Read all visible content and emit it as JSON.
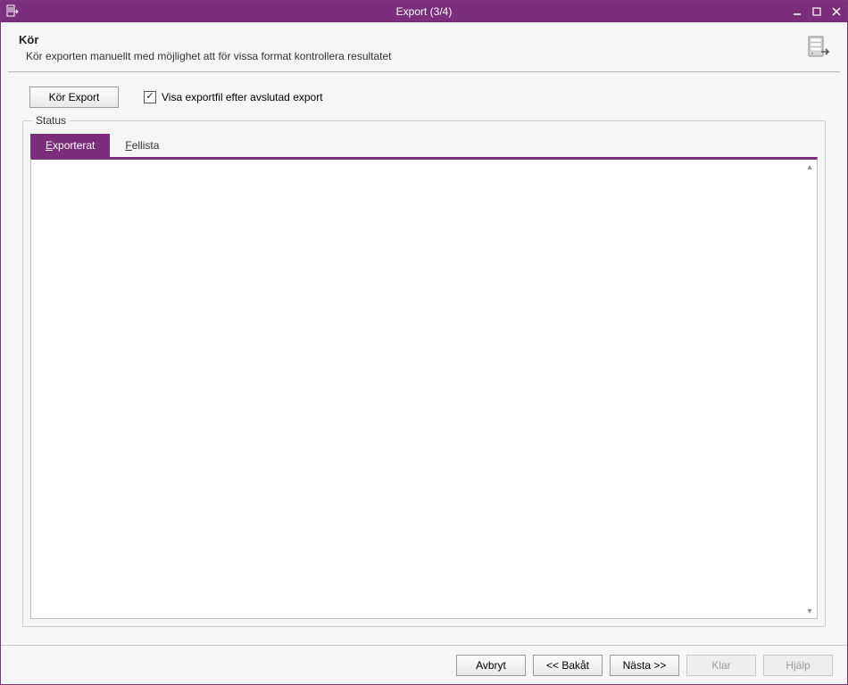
{
  "window": {
    "title": "Export (3/4)"
  },
  "header": {
    "title": "Kör",
    "subtitle": "Kör exporten manuellt med möjlighet att för vissa format kontrollera resultatet"
  },
  "controls": {
    "run_button": "Kör Export",
    "show_file_checkbox_label": "Visa exportfil efter avslutad export",
    "show_file_checked": true
  },
  "status": {
    "legend": "Status",
    "tabs": [
      {
        "label": "Exporterat",
        "accel_index": 0,
        "active": true
      },
      {
        "label": "Fellista",
        "accel_index": 0,
        "active": false
      }
    ],
    "content": ""
  },
  "footer": {
    "cancel": "Avbryt",
    "back": "<< Bakåt",
    "next": "Nästa >>",
    "finish": "Klar",
    "help": "Hjälp",
    "finish_enabled": false,
    "help_enabled": false
  },
  "colors": {
    "accent": "#7b2e7b"
  }
}
